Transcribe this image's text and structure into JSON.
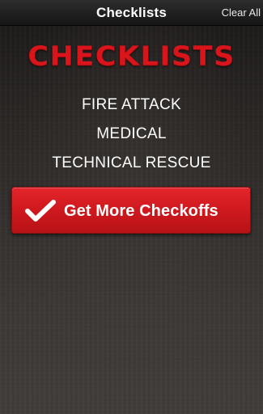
{
  "header": {
    "title": "Checklists",
    "clear_all_label": "Clear All"
  },
  "brand": {
    "logo_text": "CHECKLISTS",
    "logo_color": "#d9141a"
  },
  "menu": {
    "items": [
      {
        "label": "FIRE ATTACK"
      },
      {
        "label": "MEDICAL"
      },
      {
        "label": "TECHNICAL RESCUE"
      }
    ]
  },
  "cta": {
    "label": "Get More Checkoffs",
    "icon": "checkmark-icon",
    "color": "#d01a1f"
  }
}
